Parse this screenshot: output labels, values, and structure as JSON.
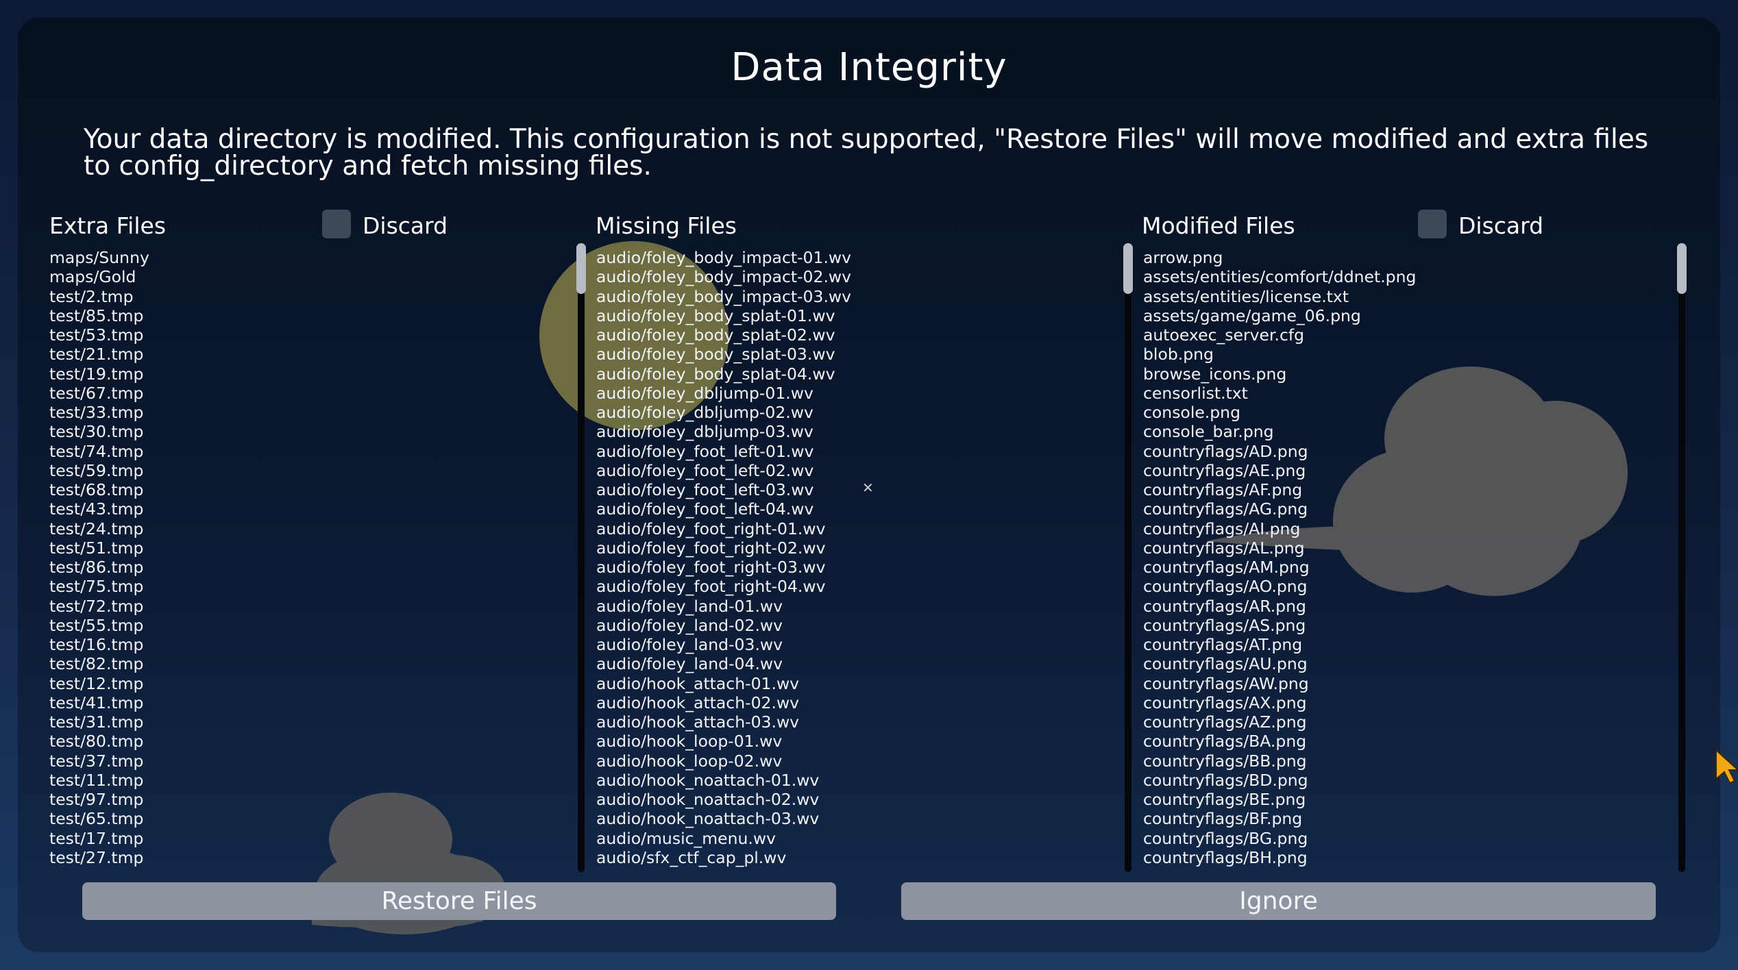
{
  "dialog": {
    "title": "Data Integrity",
    "message": "Your data directory is modified. This configuration is not supported, \"Restore Files\" will move modified and extra files to config_directory and fetch missing files."
  },
  "extra": {
    "label": "Extra Files",
    "discard_label": "Discard",
    "discard_checked": false,
    "items": [
      "maps/Sunny",
      "maps/Gold",
      "test/2.tmp",
      "test/85.tmp",
      "test/53.tmp",
      "test/21.tmp",
      "test/19.tmp",
      "test/67.tmp",
      "test/33.tmp",
      "test/30.tmp",
      "test/74.tmp",
      "test/59.tmp",
      "test/68.tmp",
      "test/43.tmp",
      "test/24.tmp",
      "test/51.tmp",
      "test/86.tmp",
      "test/75.tmp",
      "test/72.tmp",
      "test/55.tmp",
      "test/16.tmp",
      "test/82.tmp",
      "test/12.tmp",
      "test/41.tmp",
      "test/31.tmp",
      "test/80.tmp",
      "test/37.tmp",
      "test/11.tmp",
      "test/97.tmp",
      "test/65.tmp",
      "test/17.tmp",
      "test/27.tmp"
    ]
  },
  "missing": {
    "label": "Missing Files",
    "items": [
      "audio/foley_body_impact-01.wv",
      "audio/foley_body_impact-02.wv",
      "audio/foley_body_impact-03.wv",
      "audio/foley_body_splat-01.wv",
      "audio/foley_body_splat-02.wv",
      "audio/foley_body_splat-03.wv",
      "audio/foley_body_splat-04.wv",
      "audio/foley_dbljump-01.wv",
      "audio/foley_dbljump-02.wv",
      "audio/foley_dbljump-03.wv",
      "audio/foley_foot_left-01.wv",
      "audio/foley_foot_left-02.wv",
      "audio/foley_foot_left-03.wv",
      "audio/foley_foot_left-04.wv",
      "audio/foley_foot_right-01.wv",
      "audio/foley_foot_right-02.wv",
      "audio/foley_foot_right-03.wv",
      "audio/foley_foot_right-04.wv",
      "audio/foley_land-01.wv",
      "audio/foley_land-02.wv",
      "audio/foley_land-03.wv",
      "audio/foley_land-04.wv",
      "audio/hook_attach-01.wv",
      "audio/hook_attach-02.wv",
      "audio/hook_attach-03.wv",
      "audio/hook_loop-01.wv",
      "audio/hook_loop-02.wv",
      "audio/hook_noattach-01.wv",
      "audio/hook_noattach-02.wv",
      "audio/hook_noattach-03.wv",
      "audio/music_menu.wv",
      "audio/sfx_ctf_cap_pl.wv"
    ]
  },
  "modified": {
    "label": "Modified Files",
    "discard_label": "Discard",
    "discard_checked": false,
    "items": [
      "arrow.png",
      "assets/entities/comfort/ddnet.png",
      "assets/entities/license.txt",
      "assets/game/game_06.png",
      "autoexec_server.cfg",
      "blob.png",
      "browse_icons.png",
      "censorlist.txt",
      "console.png",
      "console_bar.png",
      "countryflags/AD.png",
      "countryflags/AE.png",
      "countryflags/AF.png",
      "countryflags/AG.png",
      "countryflags/AI.png",
      "countryflags/AL.png",
      "countryflags/AM.png",
      "countryflags/AO.png",
      "countryflags/AR.png",
      "countryflags/AS.png",
      "countryflags/AT.png",
      "countryflags/AU.png",
      "countryflags/AW.png",
      "countryflags/AX.png",
      "countryflags/AZ.png",
      "countryflags/BA.png",
      "countryflags/BB.png",
      "countryflags/BD.png",
      "countryflags/BE.png",
      "countryflags/BF.png",
      "countryflags/BG.png",
      "countryflags/BH.png"
    ]
  },
  "buttons": {
    "restore_label": "Restore Files",
    "ignore_label": "Ignore"
  },
  "icons": {
    "crosshair": "crosshair-icon",
    "cursor": "mouse-cursor-icon"
  },
  "colors": {
    "background": "#0b1830",
    "button": "#8e949f",
    "checkbox": "#3e4858",
    "cursor": "#f0a81a"
  }
}
